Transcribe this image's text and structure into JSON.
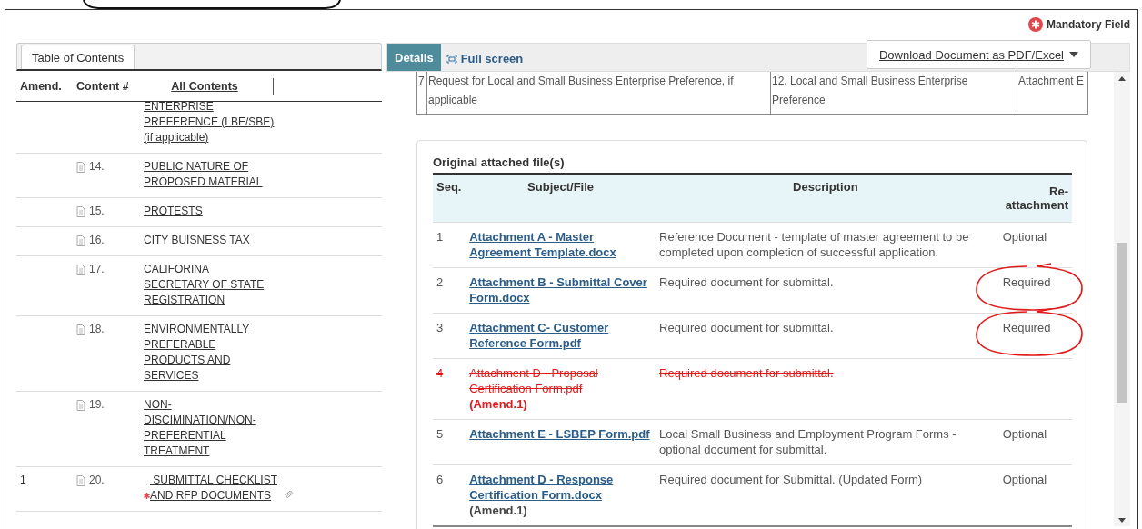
{
  "mandatory_legend": {
    "label": "Mandatory Field"
  },
  "toc": {
    "tabs": [
      {
        "label": "Table of Contents",
        "selected": true
      }
    ],
    "columns": [
      "Amend.",
      "Content #",
      "All Contents"
    ],
    "rows": [
      {
        "amend": "",
        "number": "",
        "title": "ENTERPRISE PREFERENCE (LBE/SBE) (if applicable)",
        "mandatory": false,
        "attachment": false,
        "document": false
      },
      {
        "amend": "",
        "number": "14.",
        "title": "PUBLIC NATURE OF PROPOSED MATERIAL",
        "mandatory": false,
        "attachment": false,
        "document": true
      },
      {
        "amend": "",
        "number": "15.",
        "title": "PROTESTS",
        "mandatory": false,
        "attachment": false,
        "document": true
      },
      {
        "amend": "",
        "number": "16.",
        "title": "CITY BUISNESS TAX",
        "mandatory": false,
        "attachment": false,
        "document": true
      },
      {
        "amend": "",
        "number": "17.",
        "title": "CALIFORINA SECRETARY OF STATE REGISTRATION",
        "mandatory": false,
        "attachment": false,
        "document": true
      },
      {
        "amend": "",
        "number": "18.",
        "title": "ENVIRONMENTALLY PREFERABLE PRODUCTS AND SERVICES",
        "mandatory": false,
        "attachment": false,
        "document": true
      },
      {
        "amend": "",
        "number": "19.",
        "title": "NON-DISCIMINATION/NON-PREFERENTIAL TREATMENT",
        "mandatory": false,
        "attachment": false,
        "document": true
      },
      {
        "amend": "1",
        "number": "20.",
        "title": "SUBMITTAL CHECKLIST AND RFP DOCUMENTS",
        "mandatory": true,
        "attachment": true,
        "document": true
      }
    ]
  },
  "details": {
    "tabs": [
      {
        "label": "Details",
        "selected": true
      }
    ],
    "full_screen": "Full screen",
    "download_button": "Download Document as PDF/Excel",
    "upper_table": {
      "rows": [
        [
          "7",
          "Request for Local and Small Business Enterprise Preference, if applicable",
          "12. Local and Small Business Enterprise Preference",
          "Attachment E"
        ]
      ]
    },
    "attachments": {
      "title": "Original attached file(s)",
      "columns": [
        "Seq.",
        "Subject/File",
        "Description",
        "Re-attachment"
      ],
      "rows": [
        {
          "seq": "1",
          "file": "Attachment A - Master Agreement Template.docx",
          "amend": "",
          "description": "Reference Document - template of master agreement to be completed upon completion of successful application.",
          "reattachment": "Optional",
          "deleted": false,
          "circled": false
        },
        {
          "seq": "2",
          "file": "Attachment B - Submittal Cover Form.docx",
          "amend": "",
          "description": "Required document for submittal.",
          "reattachment": "Required",
          "deleted": false,
          "circled": true
        },
        {
          "seq": "3",
          "file": "Attachment C- Customer Reference Form.pdf",
          "amend": "",
          "description": "Required document for submittal.",
          "reattachment": "Required",
          "deleted": false,
          "circled": true
        },
        {
          "seq": "4",
          "file": "Attachment D - Proposal Certification Form.pdf",
          "amend": "(Amend.1)",
          "description": "Required document for submittal.",
          "reattachment": "",
          "deleted": true,
          "circled": false
        },
        {
          "seq": "5",
          "file": "Attachment E - LSBEP Form.pdf",
          "amend": "",
          "description": "Local Small Business and Employment Program Forms - optional document for submittal.",
          "reattachment": "Optional",
          "deleted": false,
          "circled": false
        },
        {
          "seq": "6",
          "file": "Attachment D - Response Certification Form.docx",
          "amend": "(Amend.1)",
          "description": "Required document for Submittal. (Updated Form)",
          "reattachment": "Optional",
          "deleted": false,
          "circled": false
        }
      ]
    }
  }
}
